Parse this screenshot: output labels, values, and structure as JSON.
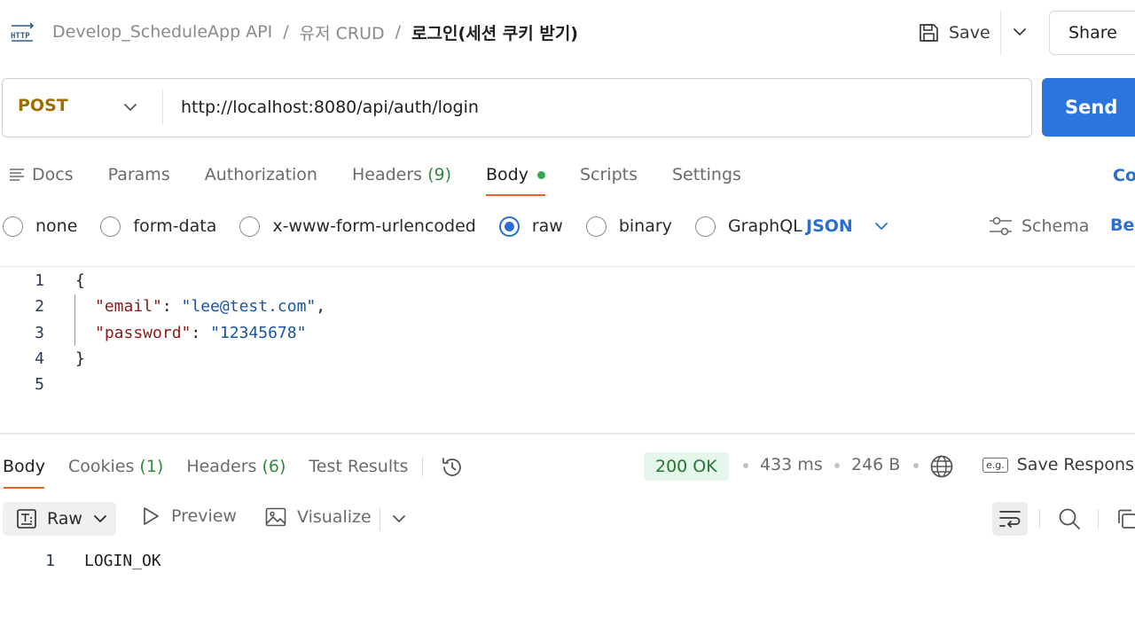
{
  "header": {
    "breadcrumb": [
      "Develop_ScheduleApp API",
      "유저 CRUD"
    ],
    "current": "로그인(세션 쿠키 받기)",
    "separator": "/",
    "save_label": "Save",
    "share_label": "Share"
  },
  "request": {
    "method": "POST",
    "url": "http://localhost:8080/api/auth/login",
    "send_label": "Send",
    "tabs": [
      {
        "label": "Docs",
        "count": ""
      },
      {
        "label": "Params",
        "count": ""
      },
      {
        "label": "Authorization",
        "count": ""
      },
      {
        "label": "Headers",
        "count": "(9)"
      },
      {
        "label": "Body",
        "count": "",
        "active": true
      },
      {
        "label": "Scripts",
        "count": ""
      },
      {
        "label": "Settings",
        "count": ""
      }
    ],
    "cookies_link": "Co",
    "body_types": [
      {
        "label": "none",
        "checked": false
      },
      {
        "label": "form-data",
        "checked": false
      },
      {
        "label": "x-www-form-urlencoded",
        "checked": false
      },
      {
        "label": "raw",
        "checked": true
      },
      {
        "label": "binary",
        "checked": false
      },
      {
        "label": "GraphQL",
        "checked": false
      }
    ],
    "format": "JSON",
    "schema_label": "Schema",
    "beautify_link": "Bea"
  },
  "editor": {
    "line_numbers": [
      "1",
      "2",
      "3",
      "4",
      "5"
    ],
    "open_brace": "{",
    "close_brace": "}",
    "email_key": "\"email\"",
    "email_value": "\"lee@test.com\"",
    "password_key": "\"password\"",
    "password_value": "\"12345678\"",
    "colon": ": ",
    "comma": ","
  },
  "response": {
    "tabs": [
      {
        "label": "Body",
        "count": "",
        "active": true
      },
      {
        "label": "Cookies",
        "count": "(1)"
      },
      {
        "label": "Headers",
        "count": "(6)"
      },
      {
        "label": "Test Results",
        "count": ""
      }
    ],
    "status": "200 OK",
    "time": "433 ms",
    "size": "246 B",
    "save_response_label": "Save Response",
    "eg_label": "e.g.",
    "view_mode": "Raw",
    "preview_label": "Preview",
    "visualize_label": "Visualize",
    "body_line_number": "1",
    "body_text": "LOGIN_OK"
  },
  "colors": {
    "send": "#2a75e0",
    "method": "#a16c00",
    "accent_underline": "#e8622c",
    "status_ok_bg": "#e7f6ea",
    "status_ok_text": "#1f7a33",
    "link_blue": "#2a6ed1",
    "json_key": "#8b1a1a",
    "json_string": "#1a55a8"
  }
}
